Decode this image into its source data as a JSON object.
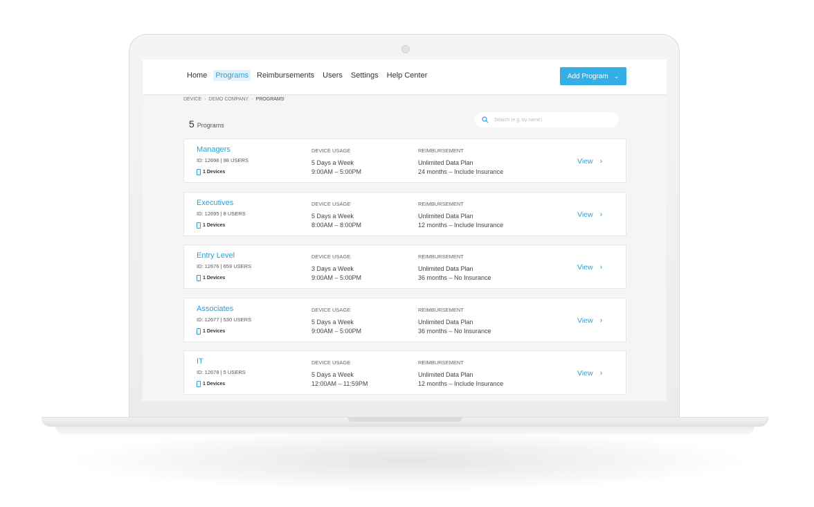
{
  "nav": {
    "items": [
      {
        "label": "Home"
      },
      {
        "label": "Programs",
        "active": true
      },
      {
        "label": "Reimbursements"
      },
      {
        "label": "Users"
      },
      {
        "label": "Settings"
      },
      {
        "label": "Help Center"
      }
    ]
  },
  "actions": {
    "add_program_label": "Add Program"
  },
  "breadcrumb": {
    "items": [
      "DEVICE",
      "DEMO COMPANY",
      "PROGRAMS"
    ]
  },
  "programs_header": {
    "count": "5",
    "label": "Programs"
  },
  "search": {
    "placeholder": "Search (e.g. by name)"
  },
  "table_headers": {
    "device_usage": "DEVICE USAGE",
    "reimbursement": "REIMBURSEMENT",
    "view": "View"
  },
  "programs": [
    {
      "name": "Managers",
      "meta": "ID: 12696 | 98 USERS",
      "devices": "1 Devices",
      "usage_days": "5 Days a Week",
      "usage_hours": "9:00AM – 5:00PM",
      "plan": "Unlimited Data Plan",
      "terms": "24 months – Include Insurance"
    },
    {
      "name": "Executives",
      "meta": "ID: 12695 | 8 USERS",
      "devices": "1 Devices",
      "usage_days": "5 Days a Week",
      "usage_hours": "8:00AM – 8:00PM",
      "plan": "Unlimited Data Plan",
      "terms": "12 months – Include Insurance"
    },
    {
      "name": "Entry Level",
      "meta": "ID: 12676 | 659 USERS",
      "devices": "1 Devices",
      "usage_days": "3 Days a Week",
      "usage_hours": "9:00AM – 5:00PM",
      "plan": "Unlimited Data Plan",
      "terms": "36 months – No Insurance"
    },
    {
      "name": "Associates",
      "meta": "ID: 12677 | 530 USERS",
      "devices": "1 Devices",
      "usage_days": "5 Days a Week",
      "usage_hours": "9:00AM – 5:00PM",
      "plan": "Unlimited Data Plan",
      "terms": "36 months – No Insurance"
    },
    {
      "name": "IT",
      "meta": "ID: 12678 | 5 USERS",
      "devices": "1 Devices",
      "usage_days": "5 Days a Week",
      "usage_hours": "12:00AM – 11:59PM",
      "plan": "Unlimited Data Plan",
      "terms": "12 months – Include Insurance"
    }
  ],
  "colors": {
    "accent": "#33aee6",
    "link": "#2a9fd6",
    "background": "#f5f5f5"
  },
  "icons": {
    "search": "search-icon",
    "device": "phone-icon",
    "dropdown": "chevron-down-icon",
    "view": "chevron-right-icon"
  }
}
